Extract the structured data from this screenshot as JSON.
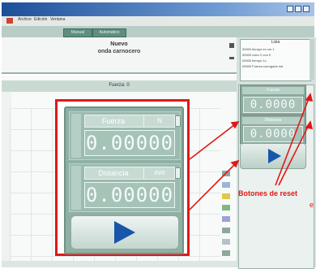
{
  "menu": {
    "items": [
      "Archivo",
      "Edición",
      "Ventana"
    ]
  },
  "toolbar": {
    "tab_left": "Manual",
    "tab_right": "Automático"
  },
  "header": {
    "title": "Nuevo",
    "subtitle": "onda carnocero"
  },
  "workspace": {
    "label": "Fuerza: 0"
  },
  "right_list": {
    "header": "Lista",
    "rows": [
      "00000   tiempo en cm 1",
      "00000   color 2 con 9",
      "00000   tiempo 1c",
      "00000   Fuerza corrugado ind"
    ]
  },
  "mini_force": {
    "label": "Fuerza",
    "value": "0.0000"
  },
  "mini_disp": {
    "label": "Distancia",
    "value": "0.0000"
  },
  "widget": {
    "force": {
      "label": "Fuerza",
      "unit": "N",
      "value": "0.00000"
    },
    "displacement": {
      "label": "Distancia",
      "unit": "mm",
      "value": "0.00000"
    },
    "play_icon": "play-icon"
  },
  "annotation": {
    "text": "Botones de reset",
    "left_mark": "e"
  },
  "colors": {
    "highlight": "#e01818",
    "play": "#1756a9",
    "panel": "#8fb0a3"
  }
}
